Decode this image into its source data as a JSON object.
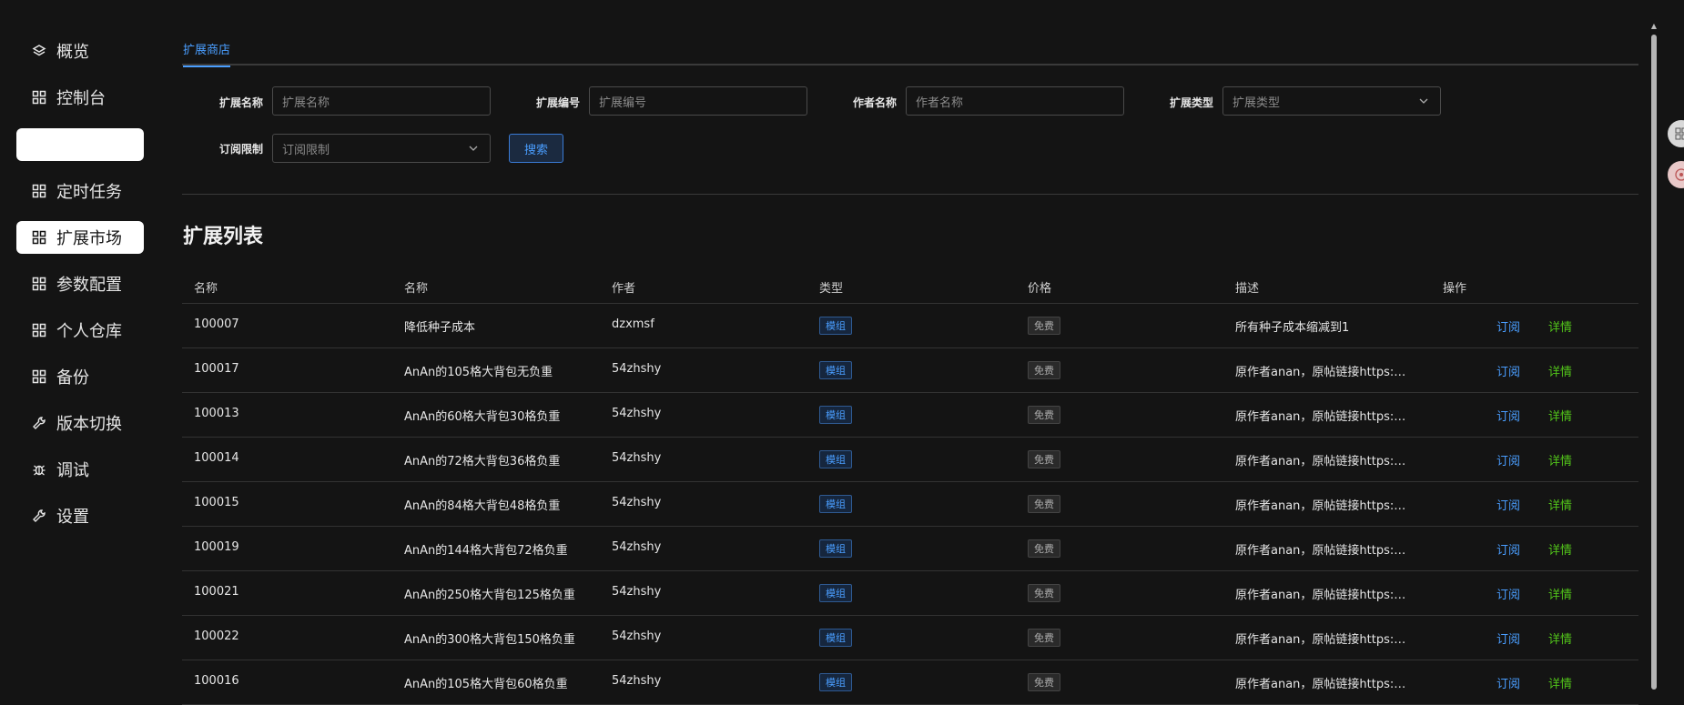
{
  "sidebar": {
    "items": [
      {
        "label": "概览",
        "icon": "layers-icon",
        "state": "normal"
      },
      {
        "label": "控制台",
        "icon": "grid-icon",
        "state": "normal"
      },
      {
        "label": "",
        "icon": "",
        "state": "blank"
      },
      {
        "label": "定时任务",
        "icon": "grid-icon",
        "state": "normal"
      },
      {
        "label": "扩展市场",
        "icon": "grid-icon",
        "state": "active"
      },
      {
        "label": "参数配置",
        "icon": "grid-icon",
        "state": "normal"
      },
      {
        "label": "个人仓库",
        "icon": "grid-icon",
        "state": "normal"
      },
      {
        "label": "备份",
        "icon": "grid-icon",
        "state": "normal"
      },
      {
        "label": "版本切换",
        "icon": "wrench-icon",
        "state": "normal"
      },
      {
        "label": "调试",
        "icon": "bug-icon",
        "state": "normal"
      },
      {
        "label": "设置",
        "icon": "wrench-icon",
        "state": "normal"
      }
    ]
  },
  "tabs": [
    {
      "label": "扩展商店",
      "active": true
    }
  ],
  "filters": {
    "name": {
      "label": "扩展名称",
      "placeholder": "扩展名称"
    },
    "id": {
      "label": "扩展编号",
      "placeholder": "扩展编号"
    },
    "author": {
      "label": "作者名称",
      "placeholder": "作者名称"
    },
    "type": {
      "label": "扩展类型",
      "placeholder": "扩展类型"
    },
    "subscription": {
      "label": "订阅限制",
      "placeholder": "订阅限制"
    },
    "search_label": "搜索"
  },
  "section_title": "扩展列表",
  "table": {
    "headers": [
      "名称",
      "名称",
      "作者",
      "类型",
      "价格",
      "描述",
      "操作"
    ],
    "subscribe_label": "订阅",
    "detail_label": "详情",
    "rows": [
      {
        "id": "100007",
        "name": "降低种子成本",
        "author": "dzxmsf",
        "type": "模组",
        "price": "免费",
        "desc": "所有种子成本缩减到1"
      },
      {
        "id": "100017",
        "name": "AnAn的105格大背包无负重",
        "author": "54zhshy",
        "type": "模组",
        "price": "免费",
        "desc": "原作者anan，原帖链接https:…"
      },
      {
        "id": "100013",
        "name": "AnAn的60格大背包30格负重",
        "author": "54zhshy",
        "type": "模组",
        "price": "免费",
        "desc": "原作者anan，原帖链接https:…"
      },
      {
        "id": "100014",
        "name": "AnAn的72格大背包36格负重",
        "author": "54zhshy",
        "type": "模组",
        "price": "免费",
        "desc": "原作者anan，原帖链接https:…"
      },
      {
        "id": "100015",
        "name": "AnAn的84格大背包48格负重",
        "author": "54zhshy",
        "type": "模组",
        "price": "免费",
        "desc": "原作者anan，原帖链接https:…"
      },
      {
        "id": "100019",
        "name": "AnAn的144格大背包72格负重",
        "author": "54zhshy",
        "type": "模组",
        "price": "免费",
        "desc": "原作者anan，原帖链接https:…"
      },
      {
        "id": "100021",
        "name": "AnAn的250格大背包125格负重",
        "author": "54zhshy",
        "type": "模组",
        "price": "免费",
        "desc": "原作者anan，原帖链接https:…"
      },
      {
        "id": "100022",
        "name": "AnAn的300格大背包150格负重",
        "author": "54zhshy",
        "type": "模组",
        "price": "免费",
        "desc": "原作者anan，原帖链接https:…"
      },
      {
        "id": "100016",
        "name": "AnAn的105格大背包60格负重",
        "author": "54zhshy",
        "type": "模组",
        "price": "免费",
        "desc": "原作者anan，原帖链接https:…"
      }
    ]
  },
  "colors": {
    "accent": "#4a9eff",
    "detail": "#52c41a",
    "background": "#141414"
  }
}
